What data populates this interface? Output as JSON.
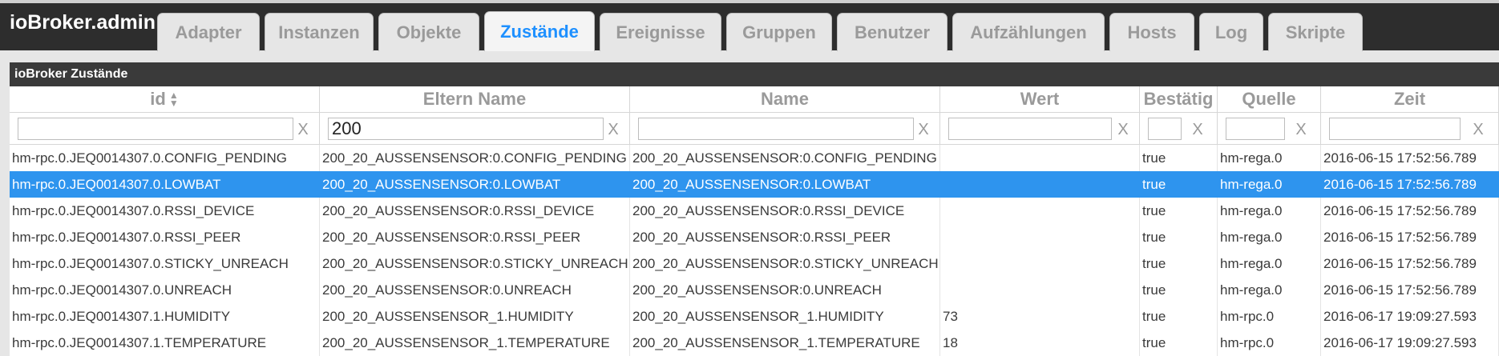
{
  "app": {
    "title": "ioBroker.admin"
  },
  "tabs": [
    {
      "label": "Adapter"
    },
    {
      "label": "Instanzen"
    },
    {
      "label": "Objekte"
    },
    {
      "label": "Zustände"
    },
    {
      "label": "Ereignisse"
    },
    {
      "label": "Gruppen"
    },
    {
      "label": "Benutzer"
    },
    {
      "label": "Aufzählungen"
    },
    {
      "label": "Hosts"
    },
    {
      "label": "Log"
    },
    {
      "label": "Skripte"
    }
  ],
  "active_tab": "Zustände",
  "panel": {
    "title": "ioBroker Zustände"
  },
  "columns": {
    "id": "id",
    "parent": "Eltern Name",
    "name": "Name",
    "value": "Wert",
    "ack": "Bestätig",
    "source": "Quelle",
    "timestamp": "Zeit"
  },
  "filters": {
    "id": "",
    "parent": "200",
    "name": "",
    "value": "",
    "ack": "",
    "source": "",
    "timestamp": "",
    "clear_label": "X"
  },
  "rows": [
    {
      "id": "hm-rpc.0.JEQ0014307.0.CONFIG_PENDING",
      "parent": "200_20_AUSSENSENSOR:0.CONFIG_PENDING",
      "name": "200_20_AUSSENSENSOR:0.CONFIG_PENDING",
      "value": "",
      "ack": "true",
      "source": "hm-rega.0",
      "timestamp": "2016-06-15 17:52:56.789"
    },
    {
      "id": "hm-rpc.0.JEQ0014307.0.LOWBAT",
      "parent": "200_20_AUSSENSENSOR:0.LOWBAT",
      "name": "200_20_AUSSENSENSOR:0.LOWBAT",
      "value": "",
      "ack": "true",
      "source": "hm-rega.0",
      "timestamp": "2016-06-15 17:52:56.789"
    },
    {
      "id": "hm-rpc.0.JEQ0014307.0.RSSI_DEVICE",
      "parent": "200_20_AUSSENSENSOR:0.RSSI_DEVICE",
      "name": "200_20_AUSSENSENSOR:0.RSSI_DEVICE",
      "value": "",
      "ack": "true",
      "source": "hm-rega.0",
      "timestamp": "2016-06-15 17:52:56.789"
    },
    {
      "id": "hm-rpc.0.JEQ0014307.0.RSSI_PEER",
      "parent": "200_20_AUSSENSENSOR:0.RSSI_PEER",
      "name": "200_20_AUSSENSENSOR:0.RSSI_PEER",
      "value": "",
      "ack": "true",
      "source": "hm-rega.0",
      "timestamp": "2016-06-15 17:52:56.789"
    },
    {
      "id": "hm-rpc.0.JEQ0014307.0.STICKY_UNREACH",
      "parent": "200_20_AUSSENSENSOR:0.STICKY_UNREACH",
      "name": "200_20_AUSSENSENSOR:0.STICKY_UNREACH",
      "value": "",
      "ack": "true",
      "source": "hm-rega.0",
      "timestamp": "2016-06-15 17:52:56.789"
    },
    {
      "id": "hm-rpc.0.JEQ0014307.0.UNREACH",
      "parent": "200_20_AUSSENSENSOR:0.UNREACH",
      "name": "200_20_AUSSENSENSOR:0.UNREACH",
      "value": "",
      "ack": "true",
      "source": "hm-rega.0",
      "timestamp": "2016-06-15 17:52:56.789"
    },
    {
      "id": "hm-rpc.0.JEQ0014307.1.HUMIDITY",
      "parent": "200_20_AUSSENSENSOR_1.HUMIDITY",
      "name": "200_20_AUSSENSENSOR_1.HUMIDITY",
      "value": "73",
      "ack": "true",
      "source": "hm-rpc.0",
      "timestamp": "2016-06-17 19:09:27.593"
    },
    {
      "id": "hm-rpc.0.JEQ0014307.1.TEMPERATURE",
      "parent": "200_20_AUSSENSENSOR_1.TEMPERATURE",
      "name": "200_20_AUSSENSENSOR_1.TEMPERATURE",
      "value": "18",
      "ack": "true",
      "source": "hm-rpc.0",
      "timestamp": "2016-06-17 19:09:27.593"
    }
  ],
  "selected_row": 1,
  "colors": {
    "accent": "#1e90ff",
    "selection": "#2e94ee",
    "header_bg": "#2d2d2d",
    "panel_title_bg": "#3a3a3a"
  },
  "icons": {
    "sort": "sort-arrows-icon",
    "clear": "clear-x-icon"
  }
}
